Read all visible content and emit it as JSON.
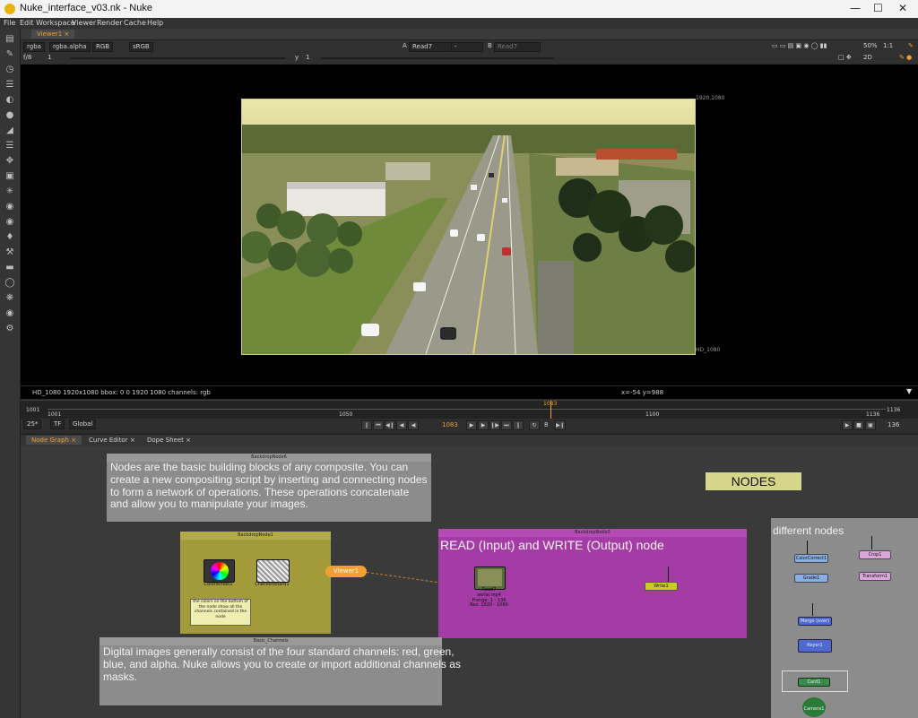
{
  "window": {
    "title": "Nuke_interface_v03.nk - Nuke"
  },
  "menu": [
    "File",
    "Edit",
    "Workspace",
    "Viewer",
    "Render",
    "Cache",
    "Help"
  ],
  "viewer": {
    "tab_label": "Viewer1",
    "channels": "rgba",
    "alpha": "rgba.alpha",
    "display": "RGB",
    "colorspace": "sRGB",
    "input_a_label": "A",
    "input_a": "Read7",
    "input_a_op": "-",
    "input_b_label": "B",
    "input_b": "Read7",
    "zoom": "50%",
    "ratio": "1:1",
    "fstop": "f/8",
    "gain": "1",
    "y_label": "y",
    "gamma": "1",
    "view_mode": "2D",
    "format_top": "1920,1080",
    "format_bottom": "HD_1080",
    "info_left": "HD_1080 1920x1080  bbox: 0 0 1920 1080 channels: rgb",
    "info_coords": "x=-54 y=988"
  },
  "timeline": {
    "start": "1001",
    "end": "1136",
    "mid": "1050",
    "tick2": "1100",
    "current": "1083",
    "fps": "25*",
    "tf": "TF",
    "range": "Global",
    "frame_field": "1083",
    "step": "8",
    "end_field": "136",
    "current_fraction": 0.6
  },
  "node_graph": {
    "tabs": [
      "Node Graph",
      "Curve Editor",
      "Dope Sheet"
    ],
    "backdrop6": {
      "title": "BackdropNode6",
      "text": "Nodes are the basic building blocks of any composite. You can create a new compositing script by inserting and connecting nodes to form a network of operations. These operations concatenate and allow you to manipulate your images."
    },
    "backdrop1": {
      "title": "BackdropNode1",
      "colorwheel_label": "ColorWheel1",
      "checkerboard_label": "CheckerBoard1",
      "sticky": "the colors on the bottom of the node show all the channels contained in the node"
    },
    "viewer_node": "Viewer1",
    "backdrop3": {
      "title": "BackdropNode3",
      "text": "READ (Input) and WRITE (Output) node",
      "read_name": "Read7",
      "read_file": "aerial.mp4",
      "read_range": "Frange: 1 - 136",
      "read_res": "Res: 1920 - 1080",
      "write_name": "Write1"
    },
    "basic_channels": {
      "title": "Basic_Channels",
      "text": "Digital images generally consist of the four standard channels: red, green, blue, and alpha. Nuke allows you to create or import additional channels as masks."
    },
    "nodes_label": "NODES",
    "different": {
      "title": "different nodes",
      "node1": "ColorCorrect1",
      "node2": "Grade1",
      "node3": "Crop1",
      "node4": "Transform1",
      "node5": "Merge (over)",
      "node6": "Keyer1",
      "node7": "Card1",
      "node8": "Camera1"
    }
  },
  "colors": {
    "accent": "#f0a030",
    "backdrop6": "#8c8c8c",
    "backdrop1": "#a39a3a",
    "backdrop3": "#a53ba5",
    "nodes_label_bg": "#d6d68a"
  }
}
